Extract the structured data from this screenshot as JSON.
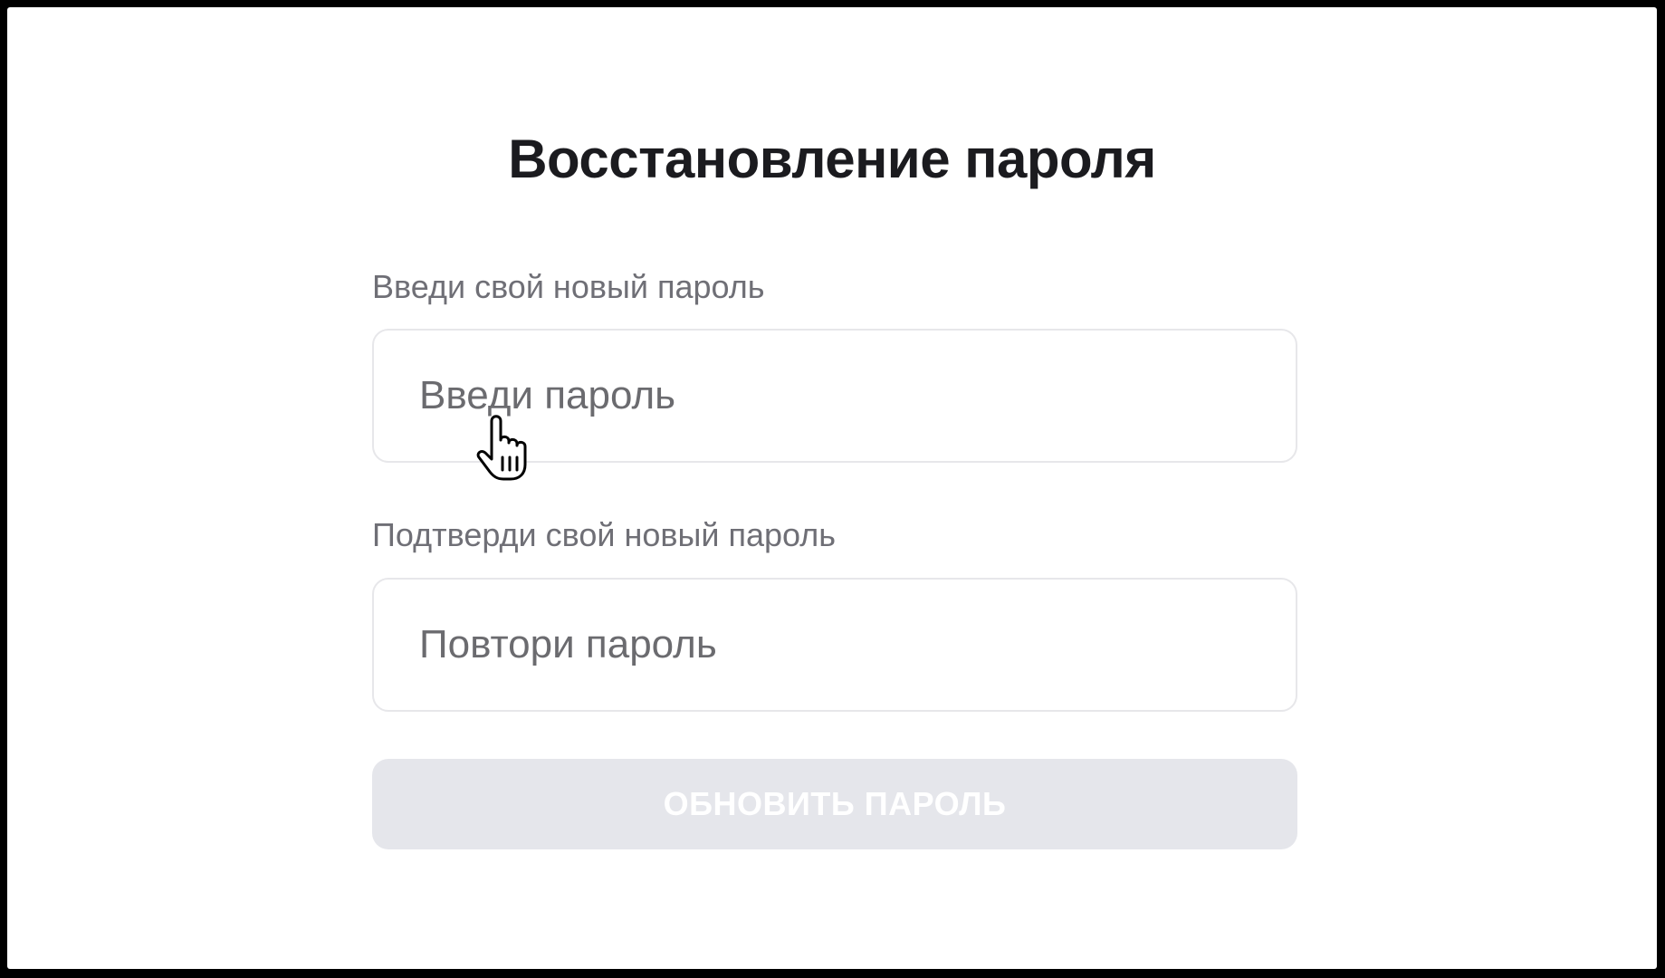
{
  "form": {
    "title": "Восстановление пароля",
    "new_password": {
      "label": "Введи свой новый пароль",
      "placeholder": "Введи пароль",
      "value": ""
    },
    "confirm_password": {
      "label": "Подтверди свой новый пароль",
      "placeholder": "Повтори пароль",
      "value": ""
    },
    "submit_label": "ОБНОВИТЬ ПАРОЛЬ",
    "submit_enabled": false
  },
  "cursor": {
    "icon": "hand-pointer-icon"
  },
  "colors": {
    "title_text": "#1b1b1f",
    "label_text": "#6f6f76",
    "placeholder_text": "#6b6b6f",
    "field_border": "#e7e7ea",
    "button_disabled_bg": "#e5e6eb",
    "button_disabled_text": "#ffffff"
  }
}
